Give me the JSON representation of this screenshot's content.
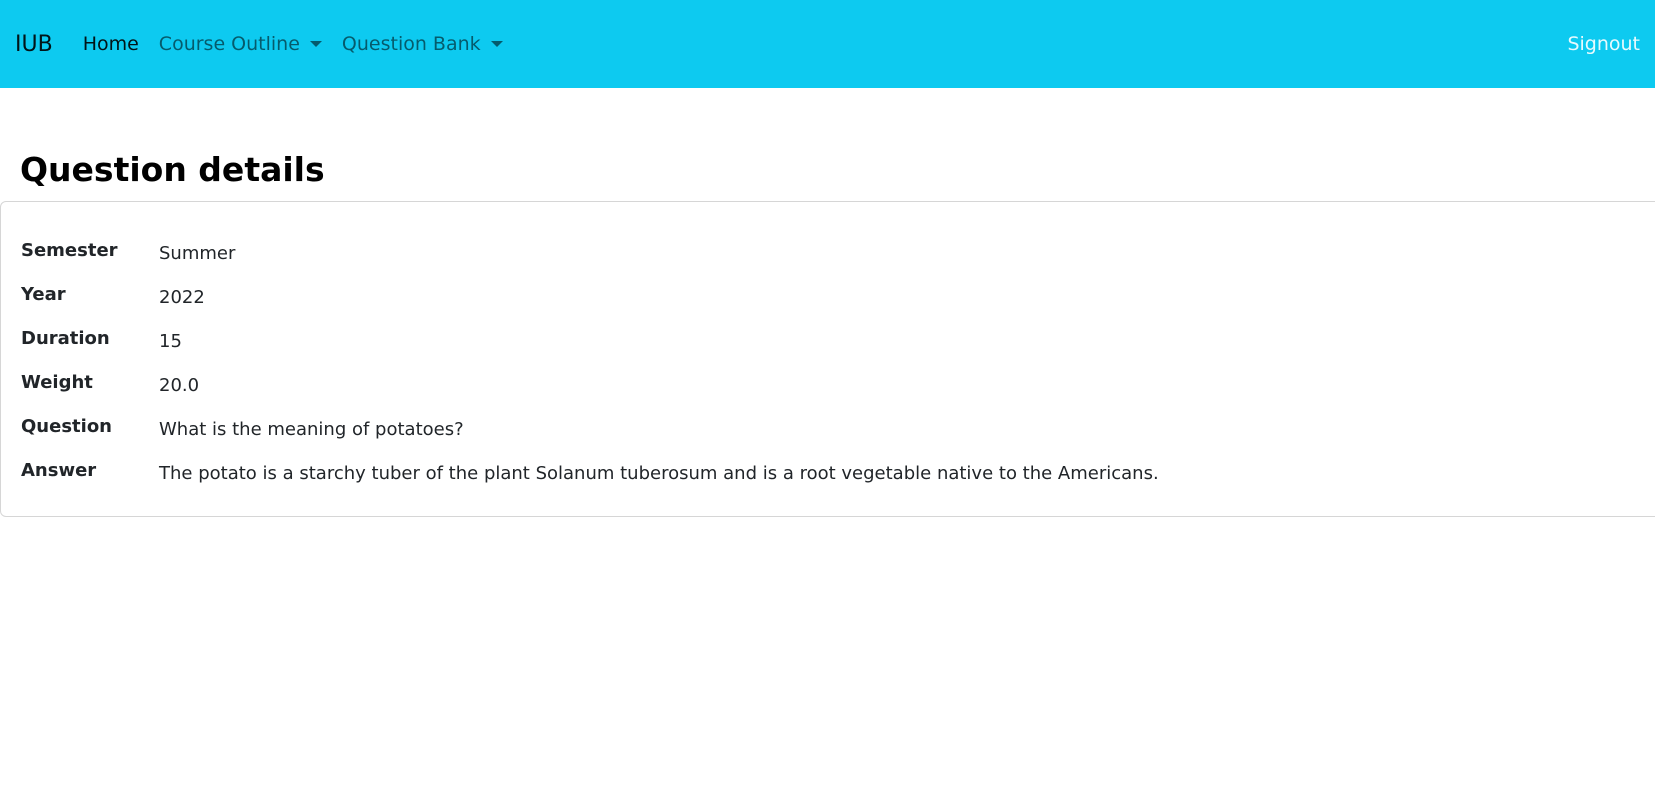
{
  "navbar": {
    "brand": "IUB",
    "home": "Home",
    "course_outline": "Course Outline",
    "question_bank": "Question Bank",
    "signout": "Signout"
  },
  "page": {
    "title": "Question details"
  },
  "details": [
    {
      "label": "Semester",
      "value": "Summer"
    },
    {
      "label": "Year",
      "value": "2022"
    },
    {
      "label": "Duration",
      "value": "15"
    },
    {
      "label": "Weight",
      "value": "20.0"
    },
    {
      "label": "Question",
      "value": "What is the meaning of potatoes?"
    },
    {
      "label": "Answer",
      "value": "The potato is a starchy tuber of the plant Solanum tuberosum and is a root vegetable native to the Americans."
    }
  ],
  "colors": {
    "navbar_bg": "#0dcaf0"
  }
}
